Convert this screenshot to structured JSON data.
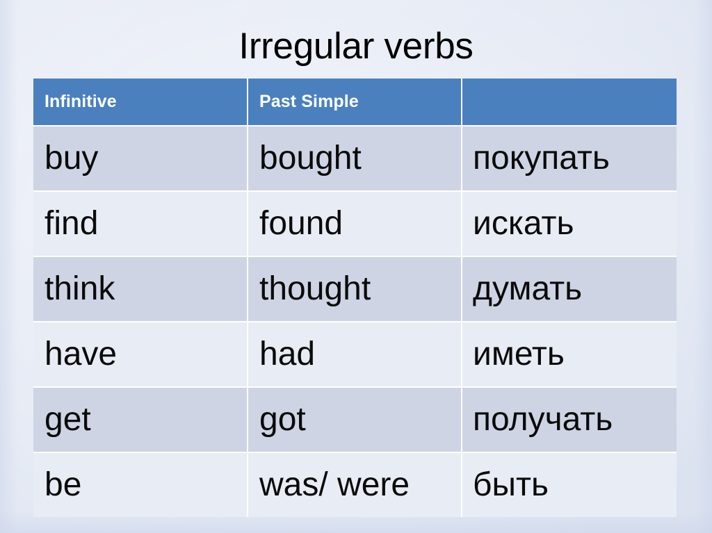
{
  "slide": {
    "title": "Irregular verbs",
    "background_color": "#e4e9f4",
    "accent_color": "#4a80be"
  },
  "table": {
    "headers": [
      {
        "label": "Infinitive"
      },
      {
        "label": "Past Simple"
      },
      {
        "label": ""
      }
    ],
    "rows": [
      {
        "infinitive": "buy",
        "past_simple": "bought",
        "translation": "покупать"
      },
      {
        "infinitive": "find",
        "past_simple": "found",
        "translation": "искать"
      },
      {
        "infinitive": "think",
        "past_simple": "thought",
        "translation": "думать"
      },
      {
        "infinitive": "have",
        "past_simple": "had",
        "translation": "иметь"
      },
      {
        "infinitive": "get",
        "past_simple": "got",
        "translation": "получать"
      },
      {
        "infinitive": "be",
        "past_simple": "was/ were",
        "translation": "быть"
      }
    ],
    "row_colors": {
      "dark": "#ced4e3",
      "light": "#e8ecf4",
      "header": "#4a80be",
      "gridline": "#ffffff"
    }
  }
}
